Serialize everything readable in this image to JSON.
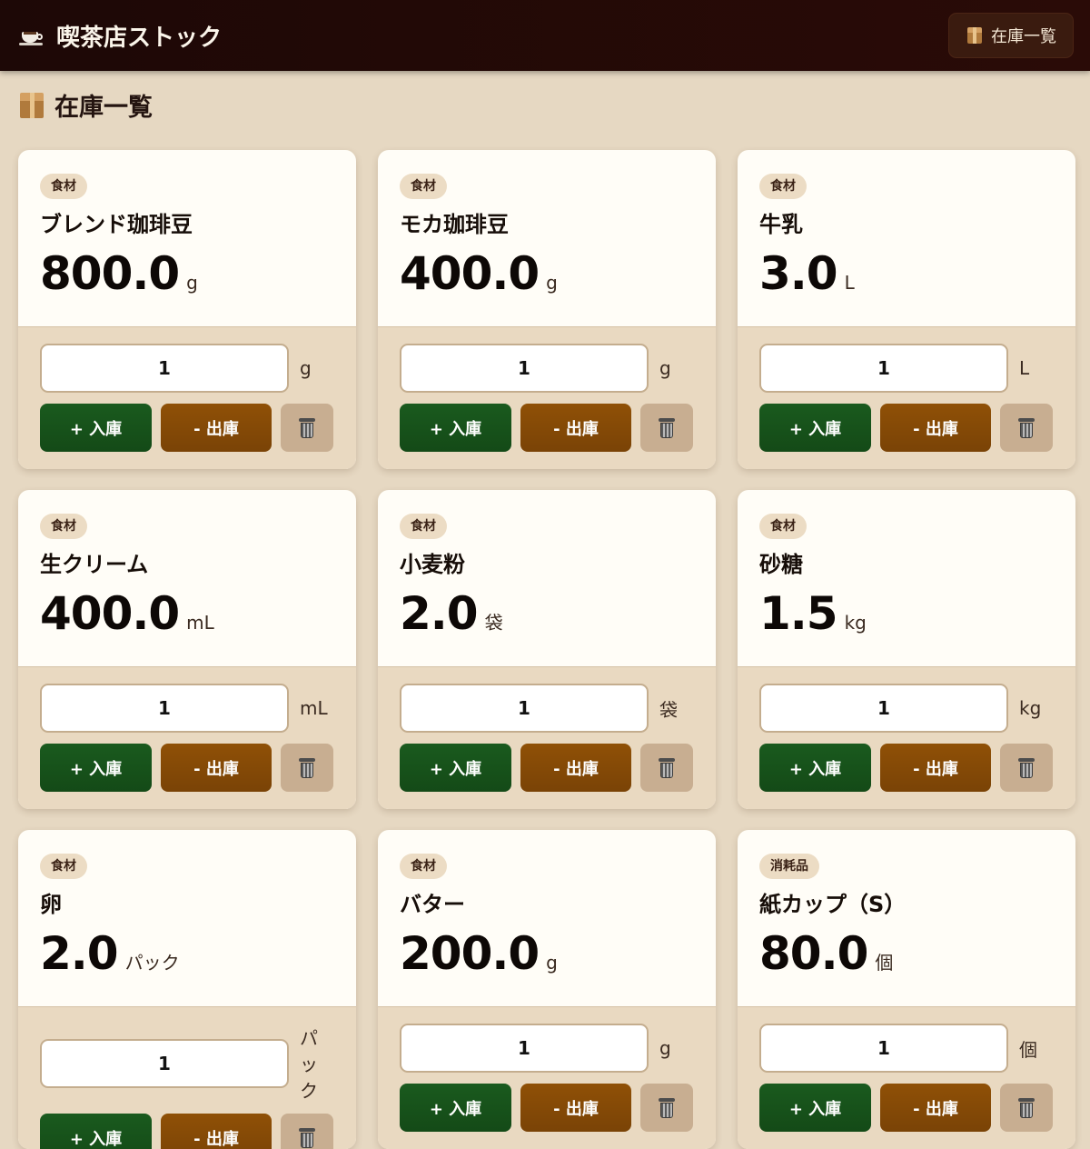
{
  "app": {
    "title": "喫茶店ストック",
    "nav_label": "在庫一覧"
  },
  "section": {
    "title": "在庫一覧"
  },
  "labels": {
    "stock_in": "+ 入庫",
    "stock_out": "- 出庫"
  },
  "items": [
    {
      "category": "食材",
      "name": "ブレンド珈琲豆",
      "quantity": "800.0",
      "unit": "g",
      "amount": "1"
    },
    {
      "category": "食材",
      "name": "モカ珈琲豆",
      "quantity": "400.0",
      "unit": "g",
      "amount": "1"
    },
    {
      "category": "食材",
      "name": "牛乳",
      "quantity": "3.0",
      "unit": "L",
      "amount": "1"
    },
    {
      "category": "食材",
      "name": "生クリーム",
      "quantity": "400.0",
      "unit": "mL",
      "amount": "1"
    },
    {
      "category": "食材",
      "name": "小麦粉",
      "quantity": "2.0",
      "unit": "袋",
      "amount": "1"
    },
    {
      "category": "食材",
      "name": "砂糖",
      "quantity": "1.5",
      "unit": "kg",
      "amount": "1"
    },
    {
      "category": "食材",
      "name": "卵",
      "quantity": "2.0",
      "unit": "パック",
      "amount": "1"
    },
    {
      "category": "食材",
      "name": "バター",
      "quantity": "200.0",
      "unit": "g",
      "amount": "1"
    },
    {
      "category": "消耗品",
      "name": "紙カップ（S）",
      "quantity": "80.0",
      "unit": "個",
      "amount": "1"
    }
  ],
  "colors": {
    "header_bg": "#1d0806",
    "page_bg": "#e6d8c2",
    "stock_in_button": "#1a5a1e",
    "stock_out_button": "#8f5006",
    "delete_button": "#c8ae91"
  },
  "icons": {
    "app": "coffee-cup-icon",
    "nav": "package-icon",
    "section": "package-icon",
    "delete": "trash-icon"
  }
}
